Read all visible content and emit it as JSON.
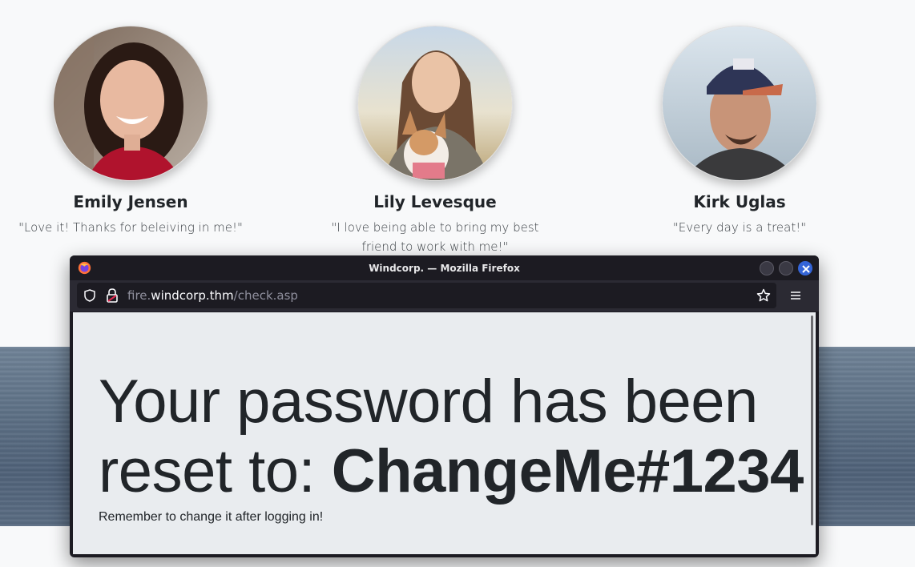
{
  "testimonials": [
    {
      "name": "Emily Jensen",
      "quote": "\"Love it! Thanks for beleiving in me!\""
    },
    {
      "name": "Lily Levesque",
      "quote": "\"I love being able to bring my best friend to work with me!\""
    },
    {
      "name": "Kirk Uglas",
      "quote": "\"Every day is a treat!\""
    }
  ],
  "browser": {
    "title": "Windcorp. — Mozilla Firefox",
    "url_prefix": "fire.",
    "url_host": "windcorp.thm",
    "url_path": "/check.asp",
    "icons": [
      "firefox-logo",
      "shield-icon",
      "lock-icon",
      "star-icon",
      "hamburger-menu-icon"
    ]
  },
  "page": {
    "headline_text": "Your password has been reset to: ",
    "password": "ChangeMe#1234",
    "subtext": "Remember to change it after logging in!"
  },
  "colors": {
    "firefox_close": "#3465d8",
    "toolbar_bg": "#2b2a33",
    "content_bg": "#e9ecef"
  }
}
